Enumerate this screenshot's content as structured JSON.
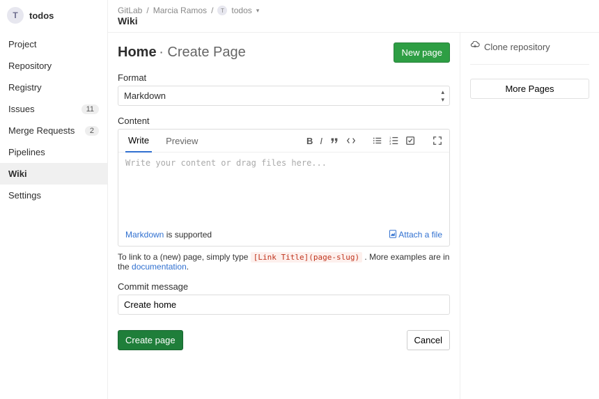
{
  "sidebar": {
    "avatar_letter": "T",
    "project_name": "todos",
    "items": [
      {
        "label": "Project",
        "badge": null
      },
      {
        "label": "Repository",
        "badge": null
      },
      {
        "label": "Registry",
        "badge": null
      },
      {
        "label": "Issues",
        "badge": "11"
      },
      {
        "label": "Merge Requests",
        "badge": "2"
      },
      {
        "label": "Pipelines",
        "badge": null
      },
      {
        "label": "Wiki",
        "badge": null
      },
      {
        "label": "Settings",
        "badge": null
      }
    ]
  },
  "breadcrumbs": {
    "root": "GitLab",
    "user": "Marcia Ramos",
    "project_letter": "T",
    "project": "todos"
  },
  "page_section": "Wiki",
  "title": {
    "main": "Home",
    "sub": "· Create Page"
  },
  "new_page_button": "New page",
  "format": {
    "label": "Format",
    "value": "Markdown"
  },
  "content": {
    "label": "Content",
    "tab_write": "Write",
    "tab_preview": "Preview",
    "placeholder": "Write your content or drag files here...",
    "markdown_label": "Markdown",
    "supported_suffix": " is supported",
    "attach_label": "Attach a file"
  },
  "help": {
    "prefix": "To link to a (new) page, simply type ",
    "code": "[Link Title](page-slug)",
    "suffix": " . More examples are in the ",
    "doc_link": "documentation",
    "period": "."
  },
  "commit": {
    "label": "Commit message",
    "value": "Create home"
  },
  "actions": {
    "create": "Create page",
    "cancel": "Cancel"
  },
  "right": {
    "clone": "Clone repository",
    "more": "More Pages"
  }
}
